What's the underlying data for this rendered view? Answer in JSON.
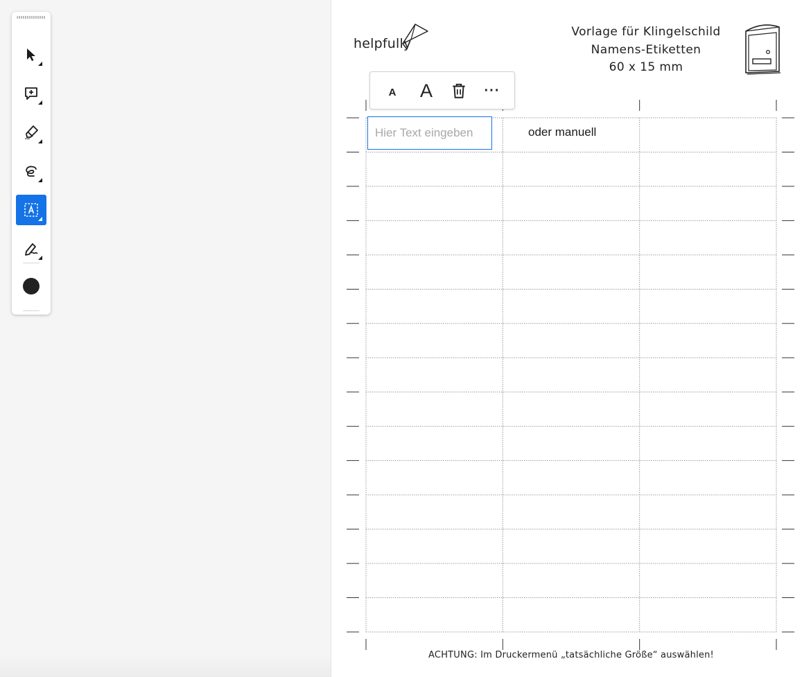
{
  "toolbar": {
    "tools": [
      {
        "name": "select",
        "icon": "arrow-pointer-icon",
        "active": false
      },
      {
        "name": "add-comment",
        "icon": "comment-plus-icon",
        "active": false
      },
      {
        "name": "highlight",
        "icon": "highlighter-icon",
        "active": false
      },
      {
        "name": "draw",
        "icon": "freehand-loop-icon",
        "active": false
      },
      {
        "name": "text-box",
        "icon": "text-box-icon",
        "active": true
      },
      {
        "name": "sign",
        "icon": "pen-sign-icon",
        "active": false
      }
    ],
    "current_color": "#222222",
    "active_color": "#1473e6"
  },
  "document": {
    "brand": "helpfully",
    "title_lines": [
      "Vorlage für Klingelschild",
      "Namens-Etiketten",
      "60 x 15 mm"
    ],
    "footer_note": "ACHTUNG: Im Druckermenü „tatsächliche Größe“ auswählen!",
    "label_grid": {
      "columns": 3,
      "rows": 15
    }
  },
  "format_bar": {
    "small_text_label": "A",
    "large_text_label": "A",
    "more_label": "···"
  },
  "label_input": {
    "placeholder": "Hier Text eingeben",
    "value": ""
  },
  "manual_label": {
    "text": "oder manuell"
  }
}
